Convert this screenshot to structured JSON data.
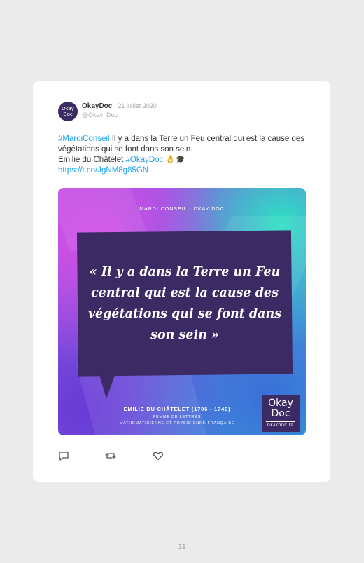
{
  "tweet": {
    "avatar": {
      "line1": "Okay",
      "line2": "Doc"
    },
    "author_name": "OkayDoc",
    "separator": " · ",
    "date": "21 juillet 2020",
    "handle": "@Okay_Doc",
    "hashtag1": "#MardiConseil",
    "text1": " Il y a dans la Terre un Feu central qui est la cause des végétations qui se font dans son sein.",
    "author_line": "Emilie du Châtelet ",
    "hashtag2": "#OkayDoc",
    "emoji": " 👌🎓",
    "link": "https://t.co/JgNM8g85GN"
  },
  "media": {
    "header": "MARDI CONSEIL - OKAY DOC",
    "quote": "« Il y a dans la Terre un Feu central qui est la cause des végétations qui se font dans son sein »",
    "credit_name": "EMILIE DU CHÂTELET (1706 - 1749)",
    "credit_role1": "FEMME DE LETTRES",
    "credit_role2": "MATHÉMATICIENNE ET PHYSICIENNE FRANÇAISE",
    "logo_line1": "Okay",
    "logo_line2": "Doc",
    "logo_line3": "OKAYDOC.FR"
  },
  "actions": [
    {
      "icon": "reply-icon"
    },
    {
      "icon": "retweet-icon"
    },
    {
      "icon": "like-icon"
    }
  ],
  "page_number": "31",
  "colors": {
    "link": "#1da1f2",
    "brand": "#3b2a63",
    "background": "#ebebeb"
  }
}
